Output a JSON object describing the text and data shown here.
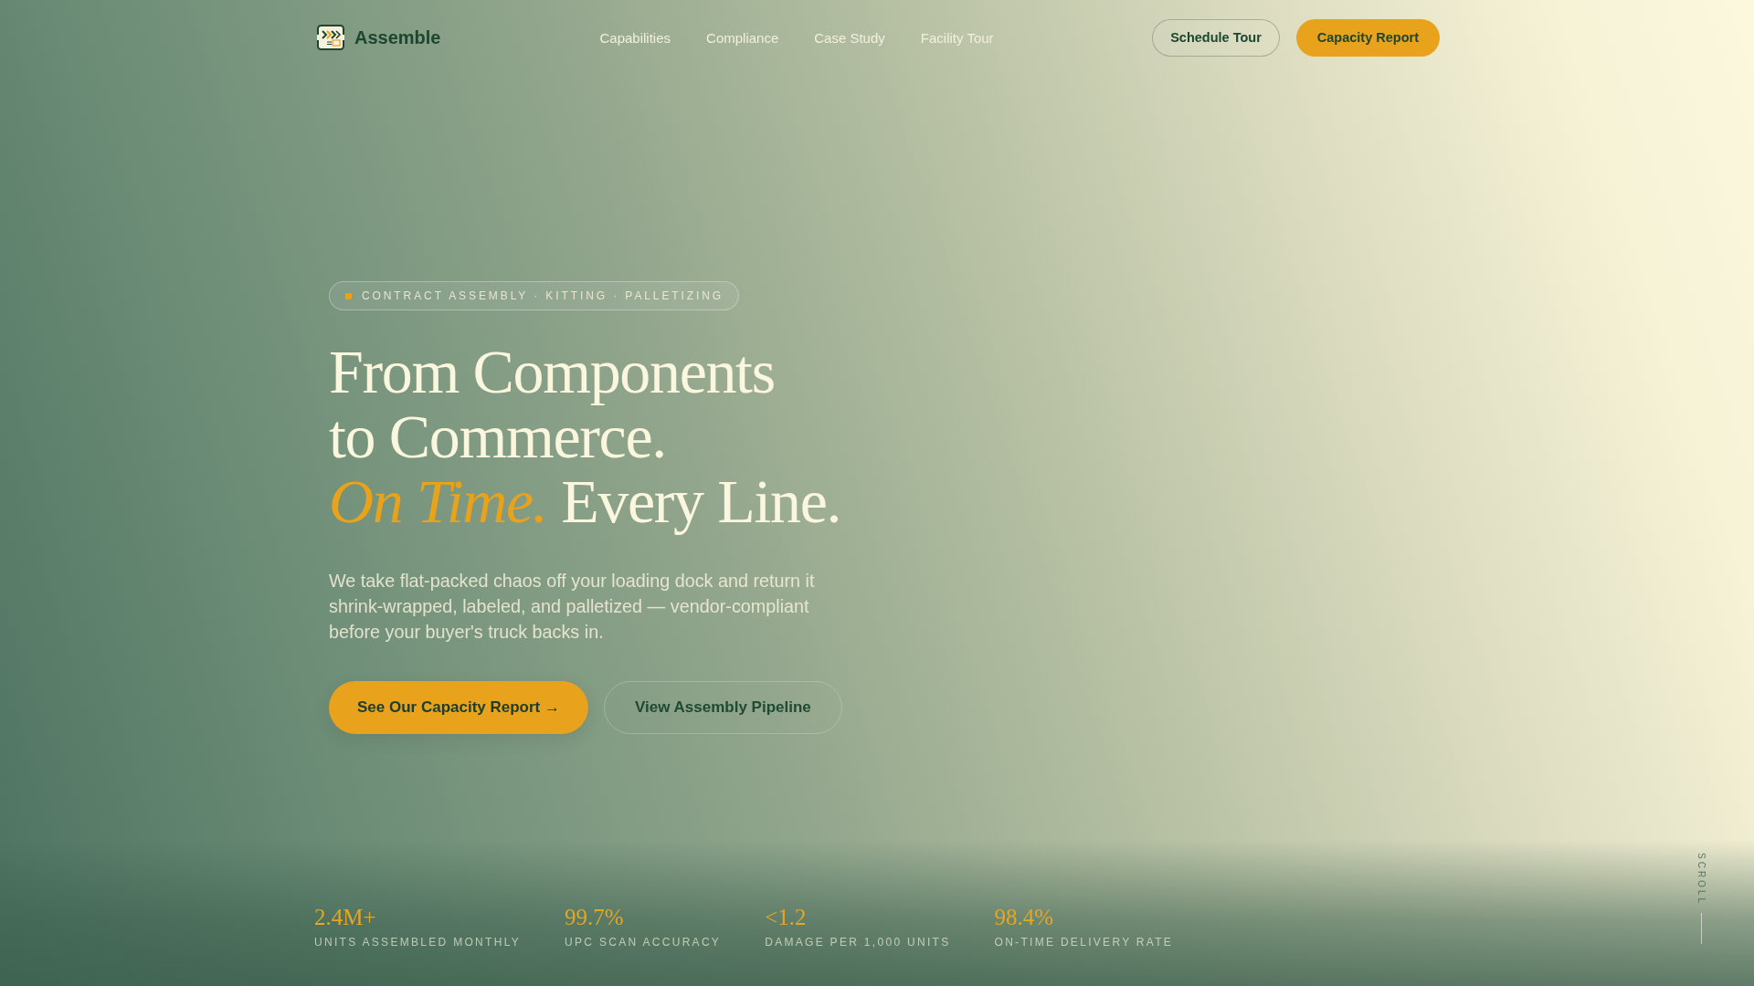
{
  "header": {
    "brand": "Assemble",
    "nav": [
      {
        "label": "Capabilities"
      },
      {
        "label": "Compliance"
      },
      {
        "label": "Case Study"
      },
      {
        "label": "Facility Tour"
      }
    ],
    "actions": [
      {
        "label": "Schedule Tour",
        "kind": "outline"
      },
      {
        "label": "Capacity Report",
        "kind": "primary"
      }
    ]
  },
  "hero": {
    "eyebrow": "CONTRACT ASSEMBLY · KITTING · PALLETIZING",
    "headline": [
      [
        {
          "text": "From Components",
          "kind": "plain"
        }
      ],
      [
        {
          "text": "to Commerce.",
          "kind": "plain"
        }
      ],
      [
        {
          "text": "On Time.",
          "kind": "accent"
        },
        {
          "text": "Every Line.",
          "kind": "plain"
        }
      ]
    ],
    "body": "We take flat-packed chaos off your loading dock and return it shrink-wrapped, labeled, and palletized — vendor-compliant before your buyer's truck backs in.",
    "buttons": [
      {
        "label": "See Our Capacity Report →",
        "kind": "primary"
      },
      {
        "label": "View Assembly Pipeline",
        "kind": "outline"
      }
    ]
  },
  "stats": [
    {
      "value": "2.4M+",
      "label": "UNITS ASSEMBLED MONTHLY"
    },
    {
      "value": "99.7%",
      "label": "UPC SCAN ACCURACY"
    },
    {
      "value": "<1.2",
      "label": "DAMAGE PER 1,000 UNITS"
    },
    {
      "value": "98.4%",
      "label": "ON-TIME DELIVERY RATE"
    }
  ],
  "scroll_hint": "SCROLL"
}
